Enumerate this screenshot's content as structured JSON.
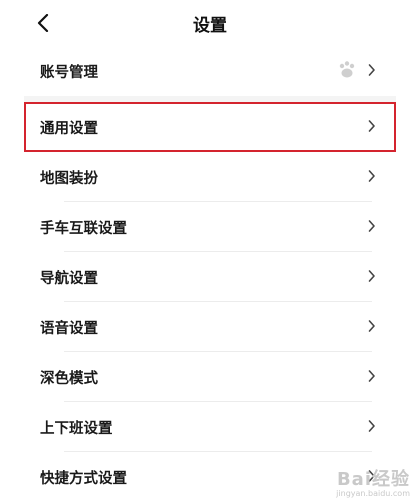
{
  "header": {
    "title": "设置",
    "back_icon": "chevron-left-icon"
  },
  "items": [
    {
      "label": "账号管理",
      "has_badge": true,
      "badge_icon": "baidu-paw-icon"
    },
    {
      "label": "通用设置",
      "highlighted": true
    },
    {
      "label": "地图装扮"
    },
    {
      "label": "手车互联设置"
    },
    {
      "label": "导航设置"
    },
    {
      "label": "语音设置"
    },
    {
      "label": "深色模式"
    },
    {
      "label": "上下班设置"
    },
    {
      "label": "快捷方式设置"
    }
  ],
  "colors": {
    "highlight_border": "#d4242e",
    "divider": "#ececec",
    "chevron": "#444444"
  },
  "watermark": {
    "text": "Bai经验",
    "sub": "jingyan.baidu.com"
  }
}
